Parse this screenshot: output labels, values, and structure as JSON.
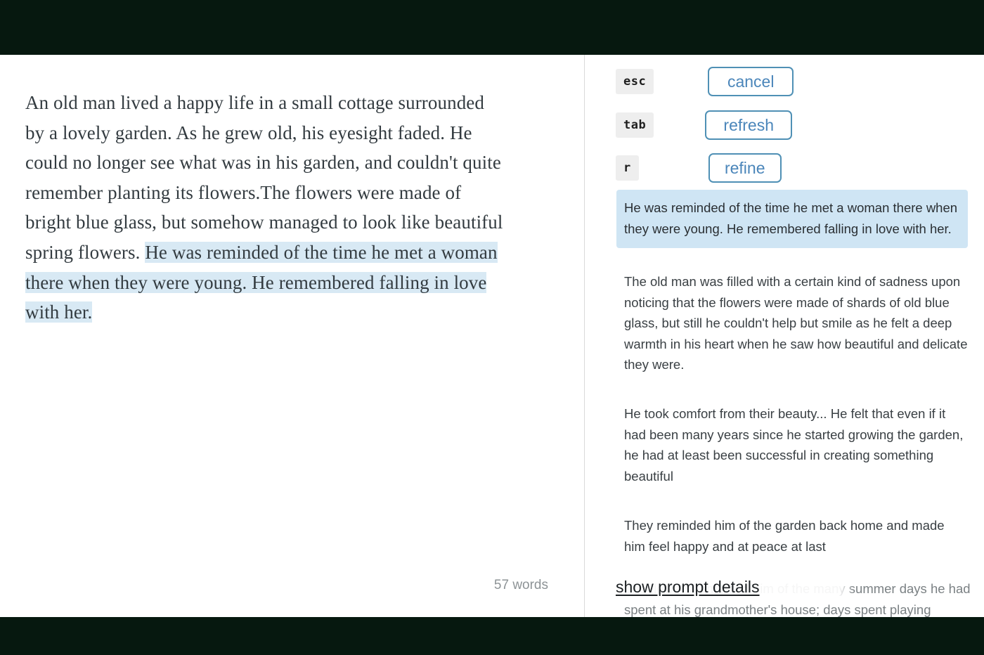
{
  "window": {
    "top_bar_color": "#06180f",
    "bottom_bar_color": "#06180f",
    "page_background": "#ffffff",
    "accent_color": "#4f90b5",
    "highlight_color": "#cfe5f4",
    "selection_color": "#d8e9f4"
  },
  "editor": {
    "document_text_before_selection": "An old man lived a happy life in a small cottage surrounded by a lovely garden. As he grew old, his eyesight faded. He could no longer see what was in his garden, and couldn't quite remember planting its flowers.The flowers were made of bright blue glass, but somehow managed to look like beautiful spring flowers. ",
    "document_selected_text": "He was reminded of the time he met a woman there when they were young. He remembered falling in love with her.",
    "word_count_number": "57",
    "word_count_label": "words"
  },
  "assistant": {
    "shortcuts": [
      {
        "key": "esc",
        "action_label": "cancel",
        "action_name": "cancel-button",
        "button_width": 122
      },
      {
        "key": "tab",
        "action_label": "refresh",
        "action_name": "refresh-button",
        "button_width": 124
      },
      {
        "key": "r",
        "action_label": "refine",
        "action_name": "refine-button",
        "button_width": 104
      }
    ],
    "selected_suggestion": "He was reminded of the time he met a woman there when they were young. He remembered falling in love with her.",
    "suggestions": [
      "The old man was filled with a certain kind of sadness upon noticing that the flowers were made of shards of old blue glass, but still he couldn't help but smile as he felt a deep warmth in his heart when he saw how beautiful and delicate they were.",
      "He took comfort from their beauty... He felt that even if it had been many years since he started growing the garden, he had at least been successful in creating something beautiful",
      "They reminded him of the garden back home and made him feel happy and at peace at last"
    ],
    "partial_suggestion": "The flowers reminded him of the many summer days he had spent at his grandmother's house; days spent playing",
    "show_prompt_details_label": "show prompt details"
  }
}
